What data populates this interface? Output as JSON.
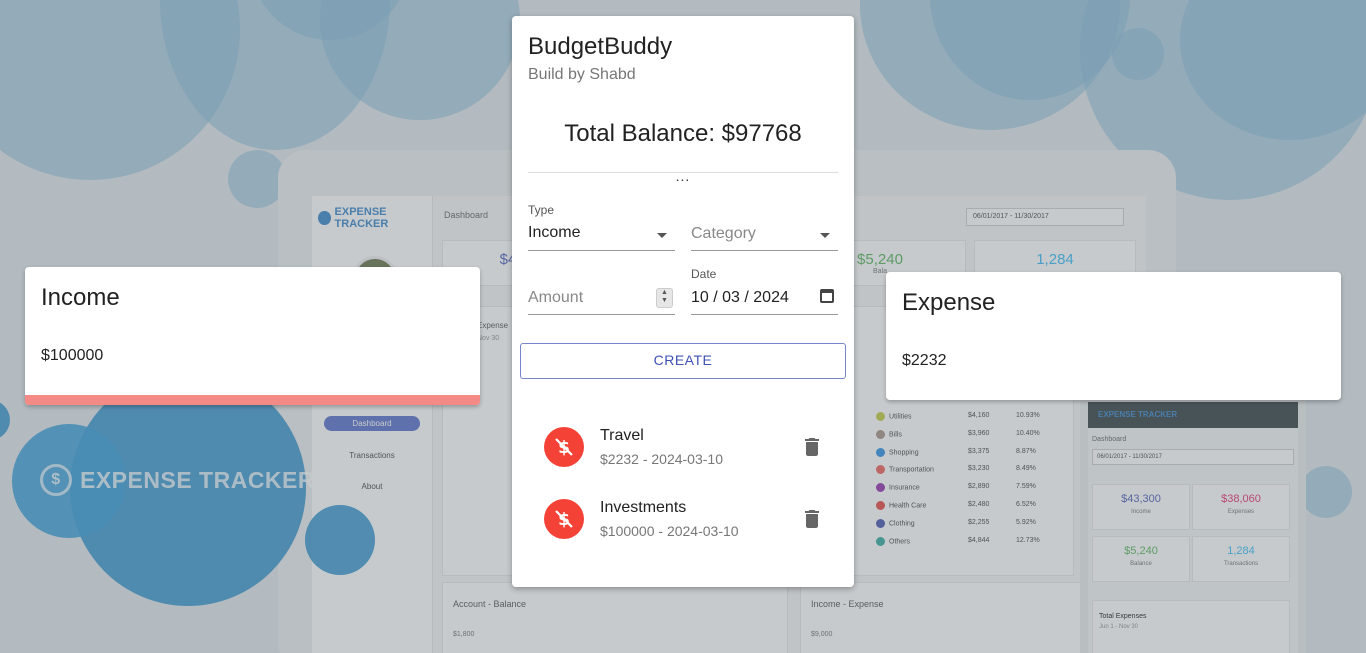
{
  "app": {
    "title": "BudgetBuddy",
    "subtitle": "Build by Shabd"
  },
  "balance": {
    "text": "Total Balance: $97768"
  },
  "more_text": "...",
  "form": {
    "type": {
      "label": "Type",
      "value": "Income"
    },
    "category": {
      "placeholder": "Category"
    },
    "amount": {
      "placeholder": "Amount"
    },
    "date": {
      "label": "Date",
      "value": "10 / 03 / 2024"
    },
    "create_label": "CREATE"
  },
  "transactions": [
    {
      "category": "Travel",
      "meta": "$2232 - 2024-03-10",
      "icon": "money-off-icon"
    },
    {
      "category": "Investments",
      "meta": "$100000 - 2024-03-10",
      "icon": "money-off-icon"
    }
  ],
  "income_card": {
    "title": "Income",
    "amount": "$100000",
    "accent": "#f48a86"
  },
  "expense_card": {
    "title": "Expense",
    "amount": "$2232"
  },
  "colors": {
    "accent": "#3f51b5",
    "expense_avatar": "#f44336"
  },
  "background": {
    "logo_text": "EXPENSE TRACKER",
    "screen": {
      "logo": "EXPENSE TRACKER",
      "header": "Dashboard",
      "date_range": "06/01/2017 - 11/30/2017",
      "stat_a": "$4",
      "stat_b": "$5,240",
      "stat_b_label": "Bala",
      "stat_c": "1,284",
      "expenses_label": "Expense",
      "expenses_range": "Nov 30",
      "nav": [
        "Dashboard",
        "Transactions",
        "About"
      ],
      "legend": [
        {
          "name": "Utilities",
          "value": "$4,160",
          "pct": "10.93%",
          "color": "#c0ca33"
        },
        {
          "name": "Bills",
          "value": "$3,960",
          "pct": "10.40%",
          "color": "#a1887f"
        },
        {
          "name": "Shopping",
          "value": "$3,375",
          "pct": "8.87%",
          "color": "#1e88e5"
        },
        {
          "name": "Transportation",
          "value": "$3,230",
          "pct": "8.49%",
          "color": "#ef5350"
        },
        {
          "name": "Insurance",
          "value": "$2,890",
          "pct": "7.59%",
          "color": "#8e24aa"
        },
        {
          "name": "Health Care",
          "value": "$2,480",
          "pct": "6.52%",
          "color": "#e53935"
        },
        {
          "name": "Clothing",
          "value": "$2,255",
          "pct": "5.92%",
          "color": "#3949ab"
        },
        {
          "name": "Others",
          "value": "$4,844",
          "pct": "12.73%",
          "color": "#26a69a"
        }
      ],
      "account_balance_label": "Account - Balance",
      "income_expense_label": "Income - Expense",
      "axis_a": "$1,800",
      "axis_b": "$9,000"
    },
    "phone": {
      "logo": "EXPENSE TRACKER",
      "label": "Dashboard",
      "date_range": "06/01/2017 - 11/30/2017",
      "stats": [
        {
          "value": "$43,300",
          "label": "Income",
          "color": "#3f51b5"
        },
        {
          "value": "$38,060",
          "label": "Expenses",
          "color": "#e91e63"
        },
        {
          "value": "$5,240",
          "label": "Balance",
          "color": "#4caf50"
        },
        {
          "value": "1,284",
          "label": "Transactions",
          "color": "#29b6f6"
        }
      ],
      "total_label": "Total Expenses",
      "total_range": "Jun 1 - Nov 30"
    }
  }
}
